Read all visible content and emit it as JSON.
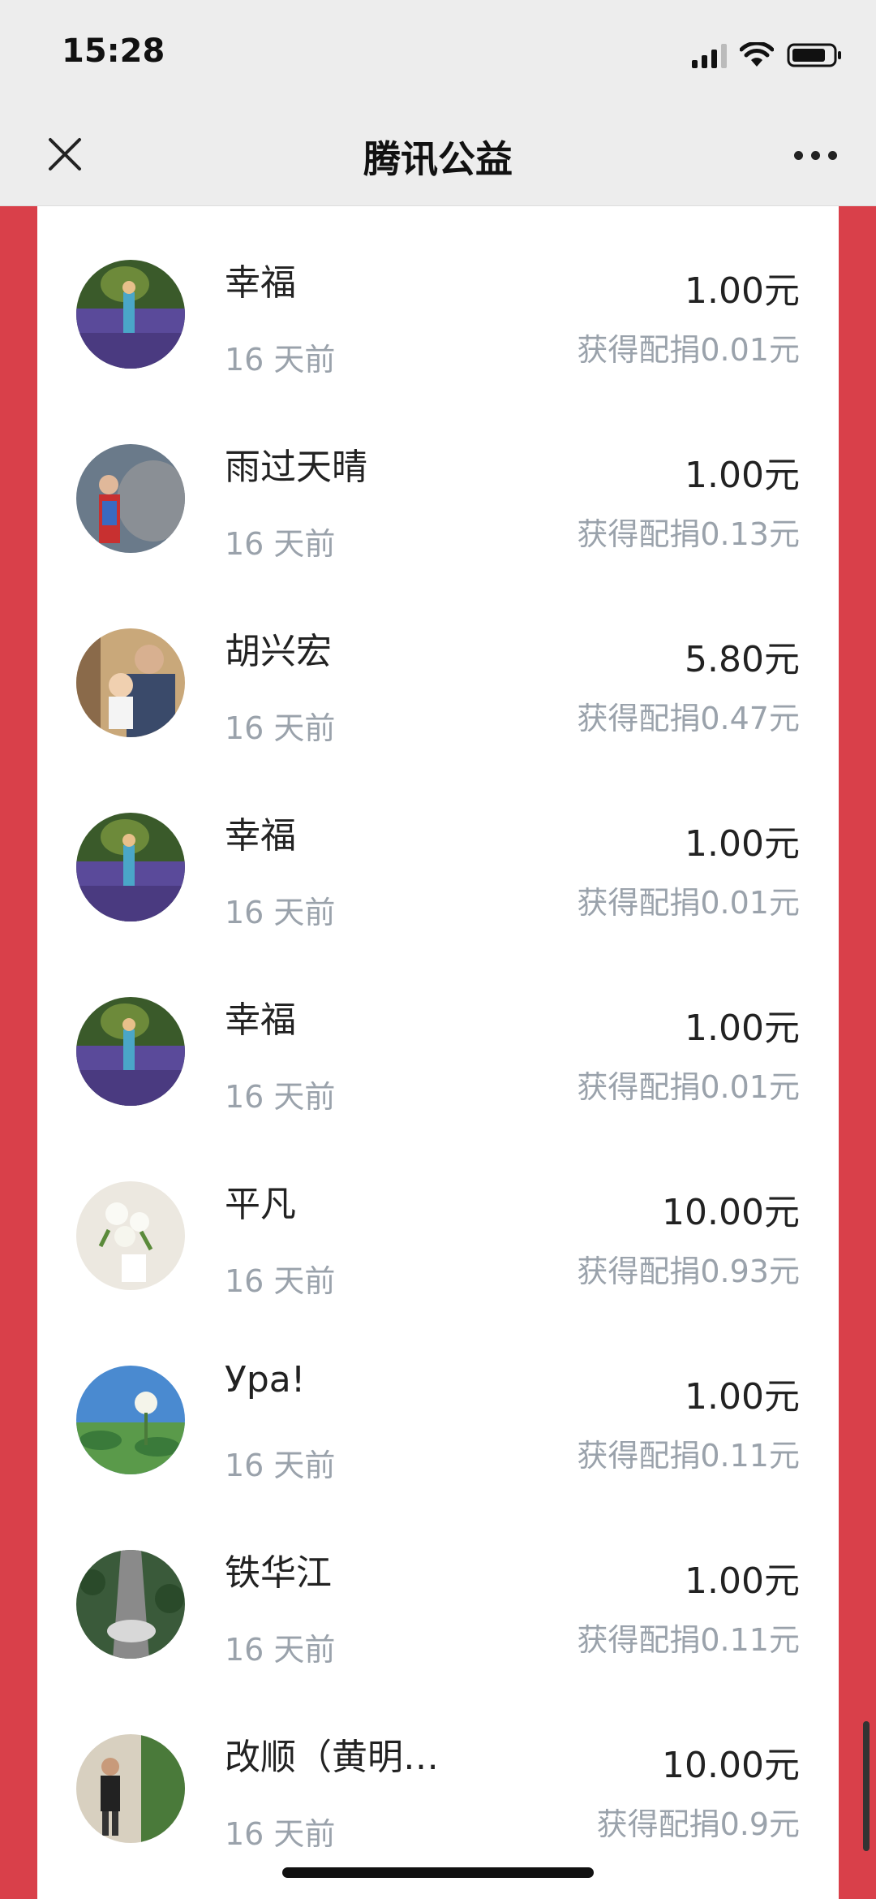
{
  "status_bar": {
    "time": "15:28"
  },
  "header": {
    "title": "腾讯公益"
  },
  "colors": {
    "accent_red": "#d9404a",
    "muted_text": "#9aa2ab"
  },
  "donations": [
    {
      "name": "幸福",
      "time": "16 天前",
      "amount": "1.00元",
      "match": "获得配捐0.01元",
      "avatar": "lavender-field"
    },
    {
      "name": "雨过天晴",
      "time": "16 天前",
      "amount": "1.00元",
      "match": "获得配捐0.13元",
      "avatar": "woman-rocks"
    },
    {
      "name": "胡兴宏",
      "time": "16 天前",
      "amount": "5.80元",
      "match": "获得配捐0.47元",
      "avatar": "man-baby"
    },
    {
      "name": "幸福",
      "time": "16 天前",
      "amount": "1.00元",
      "match": "获得配捐0.01元",
      "avatar": "lavender-field"
    },
    {
      "name": "幸福",
      "time": "16 天前",
      "amount": "1.00元",
      "match": "获得配捐0.01元",
      "avatar": "lavender-field"
    },
    {
      "name": "平凡",
      "time": "16 天前",
      "amount": "10.00元",
      "match": "获得配捐0.93元",
      "avatar": "white-flowers"
    },
    {
      "name": "Ура!",
      "time": "16 天前",
      "amount": "1.00元",
      "match": "获得配捐0.11元",
      "avatar": "lotus-sky"
    },
    {
      "name": "铁华江",
      "time": "16 天前",
      "amount": "1.00元",
      "match": "获得配捐0.11元",
      "avatar": "aerial-street"
    },
    {
      "name": "改顺（黄明…",
      "time": "16 天前",
      "amount": "10.00元",
      "match": "获得配捐0.9元",
      "avatar": "person-garden"
    }
  ]
}
